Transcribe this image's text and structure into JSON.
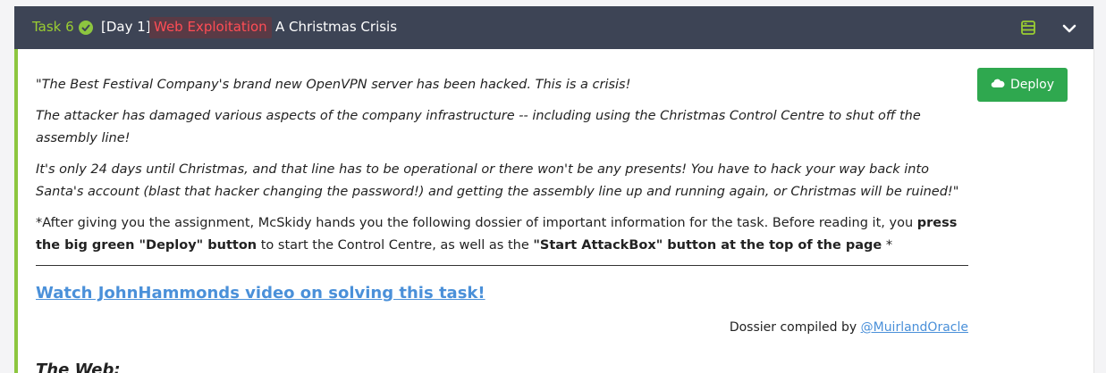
{
  "task": {
    "number_label": "Task 6",
    "day_label": "[Day 1]",
    "category": "Web Exploitation",
    "title": "A Christmas Crisis"
  },
  "deploy_button": "Deploy",
  "paragraphs": {
    "p1": "\"The Best Festival Company's brand new OpenVPN server has been hacked. This is a crisis!",
    "p2": "The attacker has damaged various aspects of the company infrastructure -- including using the Christmas Control Centre to shut off the assembly line!",
    "p3": "It's only 24 days until Christmas, and that line has to be operational or there won't be any presents! You have to hack your way  back into Santa's account (blast that hacker changing the password!) and getting the assembly line up and running again, or Christmas will be ruined!\"",
    "p4_a": "*After giving you the assignment, McSkidy hands you the following dossier of important information for the task. Before reading it, you ",
    "p4_b": "press the big green \"Deploy\" button",
    "p4_c": " to start the Control Centre, as well as the ",
    "p4_d": "\"Start AttackBox\" button at the top of the page",
    "p4_e": " *"
  },
  "video_link": "Watch JohnHammonds video on solving this task!",
  "credit": {
    "prefix": "Dossier compiled by ",
    "author": "@MuirlandOracle"
  },
  "section_heading": "The Web:",
  "colors": {
    "header_bg": "#3d4455",
    "task_green": "#9acd32",
    "tag_red": "#ff4d55",
    "deploy_green": "#2fa84f",
    "link_blue": "#4a90d9",
    "accent_border": "#8dc63f"
  }
}
